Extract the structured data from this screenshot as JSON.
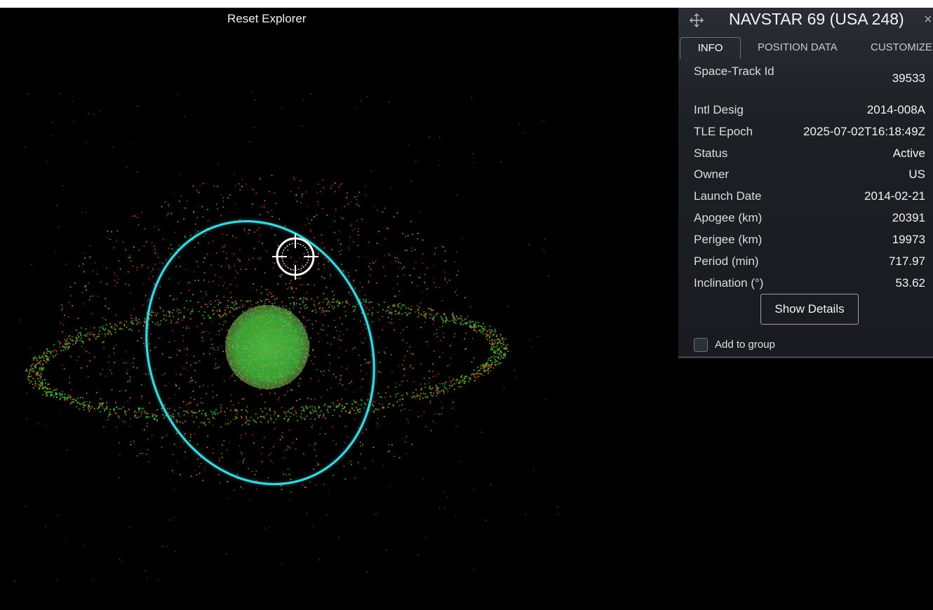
{
  "explorer": {
    "reset_label": "Reset Explorer"
  },
  "panel": {
    "title": "NAVSTAR 69 (USA 248)",
    "close_symbol": "×",
    "tabs": [
      {
        "label": "INFO",
        "active": true
      },
      {
        "label": "POSITION DATA",
        "active": false
      },
      {
        "label": "CUSTOMIZE",
        "active": false
      }
    ],
    "fields": [
      {
        "label": "Space-Track Id",
        "value": "39533"
      },
      {
        "label": "Intl Desig",
        "value": "2014-008A"
      },
      {
        "label": "TLE Epoch",
        "value": "2025-07-02T16:18:49Z"
      },
      {
        "label": "Status",
        "value": "Active"
      },
      {
        "label": "Owner",
        "value": "US"
      },
      {
        "label": "Launch Date",
        "value": "2014-02-21"
      },
      {
        "label": "Apogee (km)",
        "value": "20391"
      },
      {
        "label": "Perigee (km)",
        "value": "19973"
      },
      {
        "label": "Period (min)",
        "value": "717.97"
      },
      {
        "label": "Inclination (°)",
        "value": "53.62"
      }
    ],
    "show_details_label": "Show Details",
    "add_to_group_label": "Add to group",
    "add_to_group_checked": false
  },
  "colors": {
    "orbit_highlight": "#3fd4dc",
    "earth_green": "#3fae33",
    "debris_red": "#c0392b",
    "debris_orange": "#d9893a",
    "satellite_green": "#3ccf3c"
  },
  "icons": {
    "move": "move-icon",
    "close": "close-icon",
    "target": "target-reticle-icon"
  }
}
